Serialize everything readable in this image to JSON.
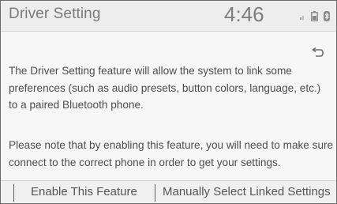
{
  "header": {
    "title": "Driver Setting",
    "clock": "4:46",
    "status_icons": [
      "signal-icon",
      "battery-icon",
      "bluetooth-icon"
    ]
  },
  "back_button": {
    "icon": "back-arrow-icon"
  },
  "content": {
    "paragraph1": [
      "The Driver Setting feature will allow the system to link some",
      "preferences (such as audio presets, button colors, language, etc.)",
      "to a paired Bluetooth phone."
    ],
    "paragraph2": [
      "Please note that by enabling this feature, you will need to make sure to",
      "connect to the correct phone in order to get your settings."
    ]
  },
  "footer": {
    "enable_label": "Enable This Feature",
    "manual_label": "Manually Select Linked Settings"
  }
}
